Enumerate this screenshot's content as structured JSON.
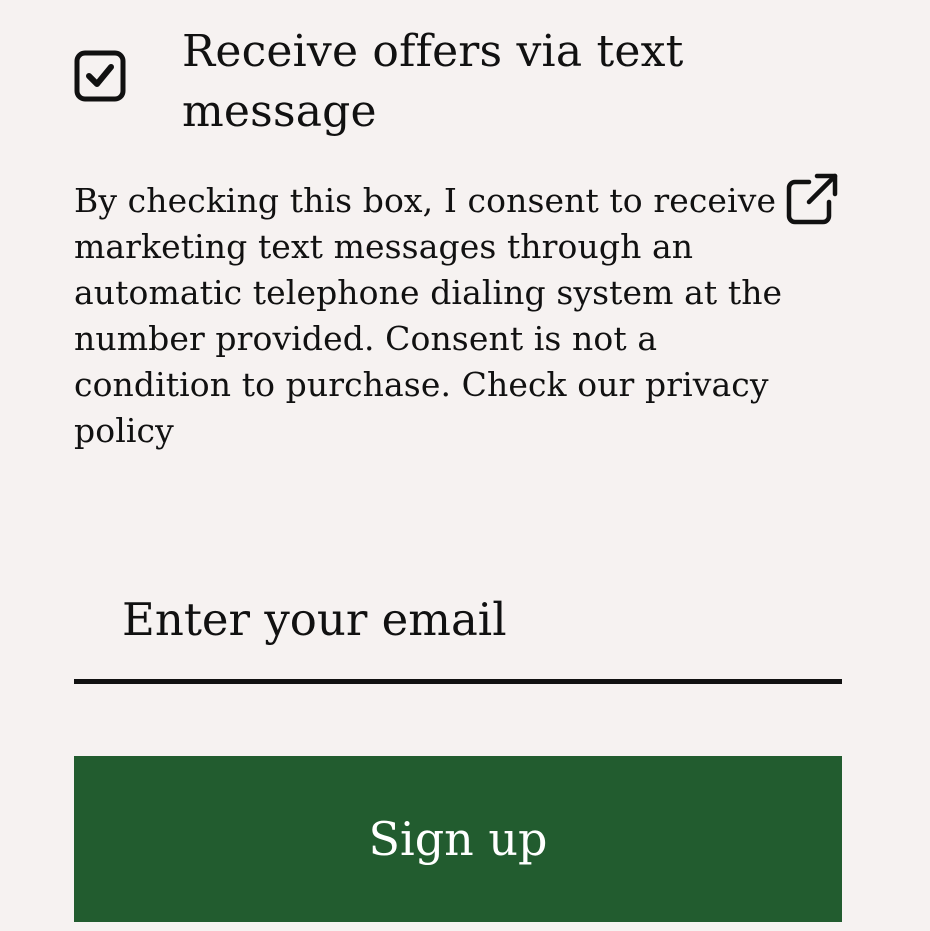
{
  "sms_optin": {
    "checked": true,
    "label": "Receive offers via text message",
    "check_icon": "check-icon",
    "consent_text": "By checking this box, I consent to receive marketing text messages through an automatic telephone dialing system at the number provided. Consent is not a condition to purchase. Check our privacy policy",
    "privacy_link_icon": "external-link-icon"
  },
  "email": {
    "placeholder": "Enter your email",
    "value": ""
  },
  "signup": {
    "label": "Sign up",
    "color": "#225c2f",
    "text_color": "#ffffff"
  },
  "colors": {
    "background": "#f6f2f1",
    "text": "#111111"
  }
}
